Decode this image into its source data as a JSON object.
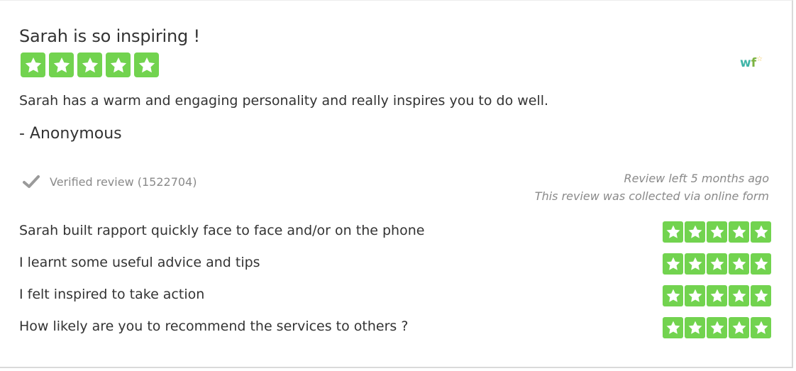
{
  "review": {
    "title": "Sarah is so inspiring !",
    "rating": 5,
    "rating_max": 5,
    "body": "Sarah has a warm and engaging personality and really inspires you to do well.",
    "author": "- Anonymous",
    "verified_text": "Verified review (1522704)",
    "left_when": "Review left 5 months ago",
    "collected_via": "This review was collected via online form"
  },
  "logo": {
    "w": "w",
    "f": "f",
    "star": "☆"
  },
  "questions": [
    {
      "label": "Sarah built rapport quickly face to face and/or on the phone",
      "rating": 5
    },
    {
      "label": "I learnt some useful advice and tips",
      "rating": 5
    },
    {
      "label": "I felt inspired to take action",
      "rating": 5
    },
    {
      "label": "How likely are you to recommend the services to others ?",
      "rating": 5
    }
  ],
  "colors": {
    "star_bg": "#72d34f",
    "muted": "#8a8a8a",
    "text": "#333333"
  },
  "icons": {
    "star": "star-icon",
    "check": "checkmark-icon"
  }
}
